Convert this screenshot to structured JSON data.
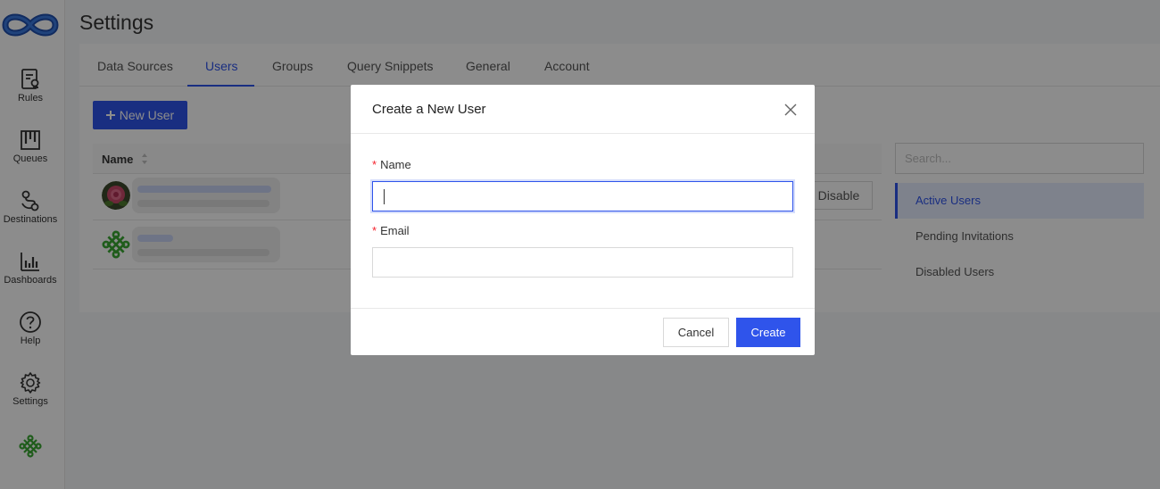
{
  "sidebar": {
    "items": [
      {
        "label": "Rules",
        "icon": "rules-icon"
      },
      {
        "label": "Queues",
        "icon": "queues-icon"
      },
      {
        "label": "Destinations",
        "icon": "destinations-icon"
      },
      {
        "label": "Dashboards",
        "icon": "dashboards-icon"
      },
      {
        "label": "Help",
        "icon": "help-icon"
      },
      {
        "label": "Settings",
        "icon": "settings-icon"
      }
    ]
  },
  "page": {
    "title": "Settings"
  },
  "tabs": [
    {
      "label": "Data Sources"
    },
    {
      "label": "Users",
      "active": true
    },
    {
      "label": "Groups"
    },
    {
      "label": "Query Snippets"
    },
    {
      "label": "General"
    },
    {
      "label": "Account"
    }
  ],
  "users": {
    "new_user_label": "New User",
    "column_name": "Name",
    "disable_label": "Disable",
    "search_placeholder": "Search...",
    "filters": [
      {
        "label": "Active Users",
        "active": true
      },
      {
        "label": "Pending Invitations"
      },
      {
        "label": "Disabled Users"
      }
    ]
  },
  "modal": {
    "title": "Create a New User",
    "name_label": "Name",
    "name_value": "",
    "email_label": "Email",
    "email_value": "",
    "cancel_label": "Cancel",
    "create_label": "Create"
  },
  "colors": {
    "accent": "#2f54eb",
    "required": "#f5222d"
  }
}
